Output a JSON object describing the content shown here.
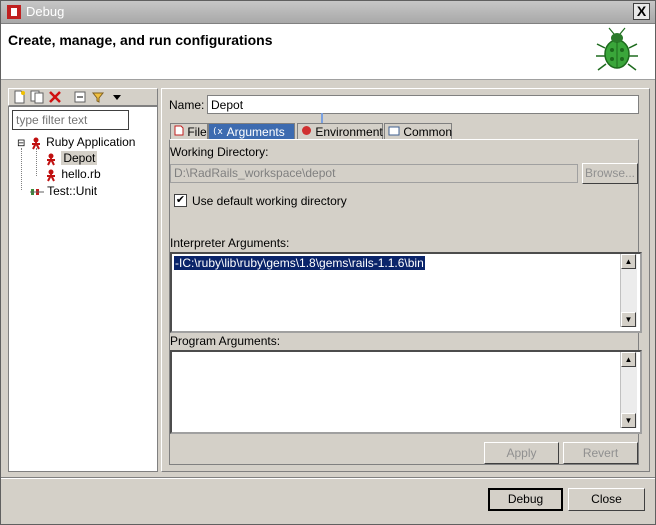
{
  "window": {
    "title": "Debug",
    "close_label": "X"
  },
  "header": {
    "title": "Create, manage, and run configurations"
  },
  "left": {
    "filter_placeholder": "type filter text",
    "tree": [
      {
        "label": "Ruby Application",
        "expander": "⊟"
      },
      {
        "label": "Depot",
        "selected": true
      },
      {
        "label": "hello.rb"
      },
      {
        "label": "Test::Unit"
      }
    ]
  },
  "config": {
    "name_label": "Name:",
    "name_value": "Depot",
    "tabs": [
      {
        "label": "File",
        "icon": "file-icon"
      },
      {
        "label": "Arguments",
        "icon": "arguments-icon",
        "active": true
      },
      {
        "label": "Environment",
        "icon": "environment-icon"
      },
      {
        "label": "Common",
        "icon": "common-icon"
      }
    ],
    "working_dir_label": "Working Directory:",
    "working_dir_value": "D:\\RadRails_workspace\\depot",
    "browse_label": "Browse...",
    "use_default_label": "Use default working directory",
    "use_default_checked": true,
    "interpreter_label": "Interpreter Arguments:",
    "interpreter_value": "-IC:\\ruby\\lib\\ruby\\gems\\1.8\\gems\\rails-1.1.6\\bin",
    "program_label": "Program Arguments:",
    "program_value": ""
  },
  "buttons": {
    "apply": "Apply",
    "revert": "Revert",
    "debug": "Debug",
    "close": "Close"
  },
  "colors": {
    "selection": "#0a246a",
    "active_tab": "#3d6bb0",
    "dialog_bg": "#d4d0c8"
  }
}
